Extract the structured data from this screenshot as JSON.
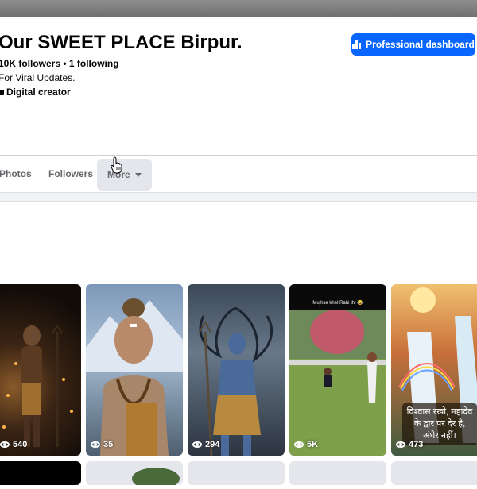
{
  "profile": {
    "name": "Our SWEET PLACE Birpur.",
    "stats": "10K followers • 1 following",
    "bio": "For Viral Updates.",
    "category": "Digital creator",
    "dashboard_button": "Professional dashboard"
  },
  "tabs": {
    "photos": "Photos",
    "followers": "Followers",
    "more": "More"
  },
  "reels": [
    {
      "views": "540"
    },
    {
      "views": "35"
    },
    {
      "views": "294"
    },
    {
      "views": "5K",
      "caption": "Mujhse khel Rahi thi 😂"
    },
    {
      "views": "473",
      "overlay": "विश्वास रखो, महादेव के द्वार पर देर है, अंधेर नहीं।"
    }
  ],
  "colors": {
    "accent": "#0866ff",
    "tab_text": "#65676b",
    "tab_active_bg": "#e4e6eb"
  },
  "icons": {
    "dashboard": "bar-chart-icon",
    "category": "briefcase-icon",
    "views": "eye-icon",
    "more": "caret-down-icon"
  }
}
